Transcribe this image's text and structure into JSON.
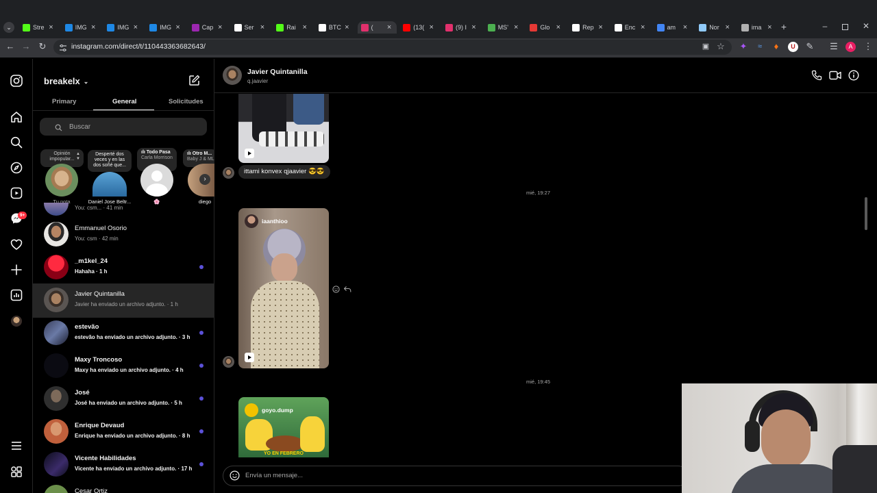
{
  "browser": {
    "tabs": [
      {
        "label": "Stre",
        "icon": "kick-icon",
        "color": "#53fc18"
      },
      {
        "label": "IMG",
        "icon": "imdb-icon",
        "color": "#1e88e5"
      },
      {
        "label": "IMG",
        "icon": "imdb-icon",
        "color": "#1e88e5"
      },
      {
        "label": "IMG",
        "icon": "imdb-icon",
        "color": "#1e88e5"
      },
      {
        "label": "Cap",
        "icon": "feather-icon",
        "color": "#9c27b0"
      },
      {
        "label": "Ser",
        "icon": "tiktok-icon",
        "color": "#ffffff"
      },
      {
        "label": "Rai",
        "icon": "kick-icon",
        "color": "#53fc18"
      },
      {
        "label": "BTC",
        "icon": "tradingview-icon",
        "color": "#ffffff"
      },
      {
        "label": "(",
        "icon": "instagram-icon",
        "color": "#e1306c"
      },
      {
        "label": "(13(",
        "icon": "youtube-icon",
        "color": "#ff0000"
      },
      {
        "label": "(9) I",
        "icon": "instagram-icon",
        "color": "#e1306c"
      },
      {
        "label": "MS'",
        "icon": "chart-icon",
        "color": "#4caf50"
      },
      {
        "label": "Glo",
        "icon": "glove-icon",
        "color": "#e53935"
      },
      {
        "label": "Rep",
        "icon": "openai-icon",
        "color": "#ffffff"
      },
      {
        "label": "Enc",
        "icon": "tiktok-icon",
        "color": "#ffffff"
      },
      {
        "label": "am",
        "icon": "google-icon",
        "color": "#4285f4"
      },
      {
        "label": "Nor",
        "icon": "globe-icon",
        "color": "#90caf9"
      },
      {
        "label": "ima",
        "icon": "globe-icon",
        "color": "#b0b0b0"
      }
    ],
    "url": "instagram.com/direct/t/110443363682643/",
    "profile_initial": "A",
    "extension_initial": "U"
  },
  "inbox": {
    "username": "breakelx",
    "tabs": [
      "Primary",
      "General",
      "Solicitudes"
    ],
    "active_tab": "General",
    "search_placeholder": "Buscar",
    "notes": [
      {
        "bubble": "Opinión impopular...",
        "name": "Tu nota"
      },
      {
        "bubble": "Desperté dos veces y en las dos soñé que...",
        "name": "Daniel Jose Beltr..."
      },
      {
        "bubble_title": "ılı Todo Pasa",
        "bubble_sub": "Carla Morrison",
        "name": "🌸"
      },
      {
        "bubble_title": "ılı Otro M...",
        "bubble_sub": "Baby J & ML",
        "name": "diego"
      }
    ],
    "partial_preview": "You: csm... · 41 min",
    "conversations": [
      {
        "name": "Emmanuel Osorio",
        "preview": "You: csm · 42 min",
        "unread": false
      },
      {
        "name": "_m1kel_24",
        "preview": "Hahaha · 1 h",
        "unread": true
      },
      {
        "name": "Javier Quintanilla",
        "preview": "Javier ha enviado un archivo adjunto. · 1 h",
        "unread": false
      },
      {
        "name": "estevão",
        "preview": "estevão ha enviado un archivo adjunto. · 3 h",
        "unread": true
      },
      {
        "name": "Maxy Troncoso",
        "preview": "Maxy ha enviado un archivo adjunto. · 4 h",
        "unread": true
      },
      {
        "name": "José",
        "preview": "José ha enviado un archivo adjunto. · 5 h",
        "unread": true
      },
      {
        "name": "Enrique Devaud",
        "preview": "Enrique ha enviado un archivo adjunto. · 8 h",
        "unread": true
      },
      {
        "name": "Vicente Habilidades",
        "preview": "Vicente ha enviado un archivo adjunto. · 17 h",
        "unread": true
      },
      {
        "name": "Cesar Ortiz",
        "preview": "",
        "unread": false
      }
    ],
    "notifications_badge": "9+"
  },
  "chat": {
    "name": "Javier Quintanilla",
    "handle": "q.jaavier",
    "message_text": "ittami konvex qjaavier 😎😎",
    "timestamp_1": "mié, 19:27",
    "timestamp_2": "mié, 19:45",
    "reel_1_author": "iaanthioo",
    "reel_2_author": "goyo.dump",
    "reel_2_caption": "YO EN FEBRERO",
    "composer_placeholder": "Envía un mensaje..."
  }
}
